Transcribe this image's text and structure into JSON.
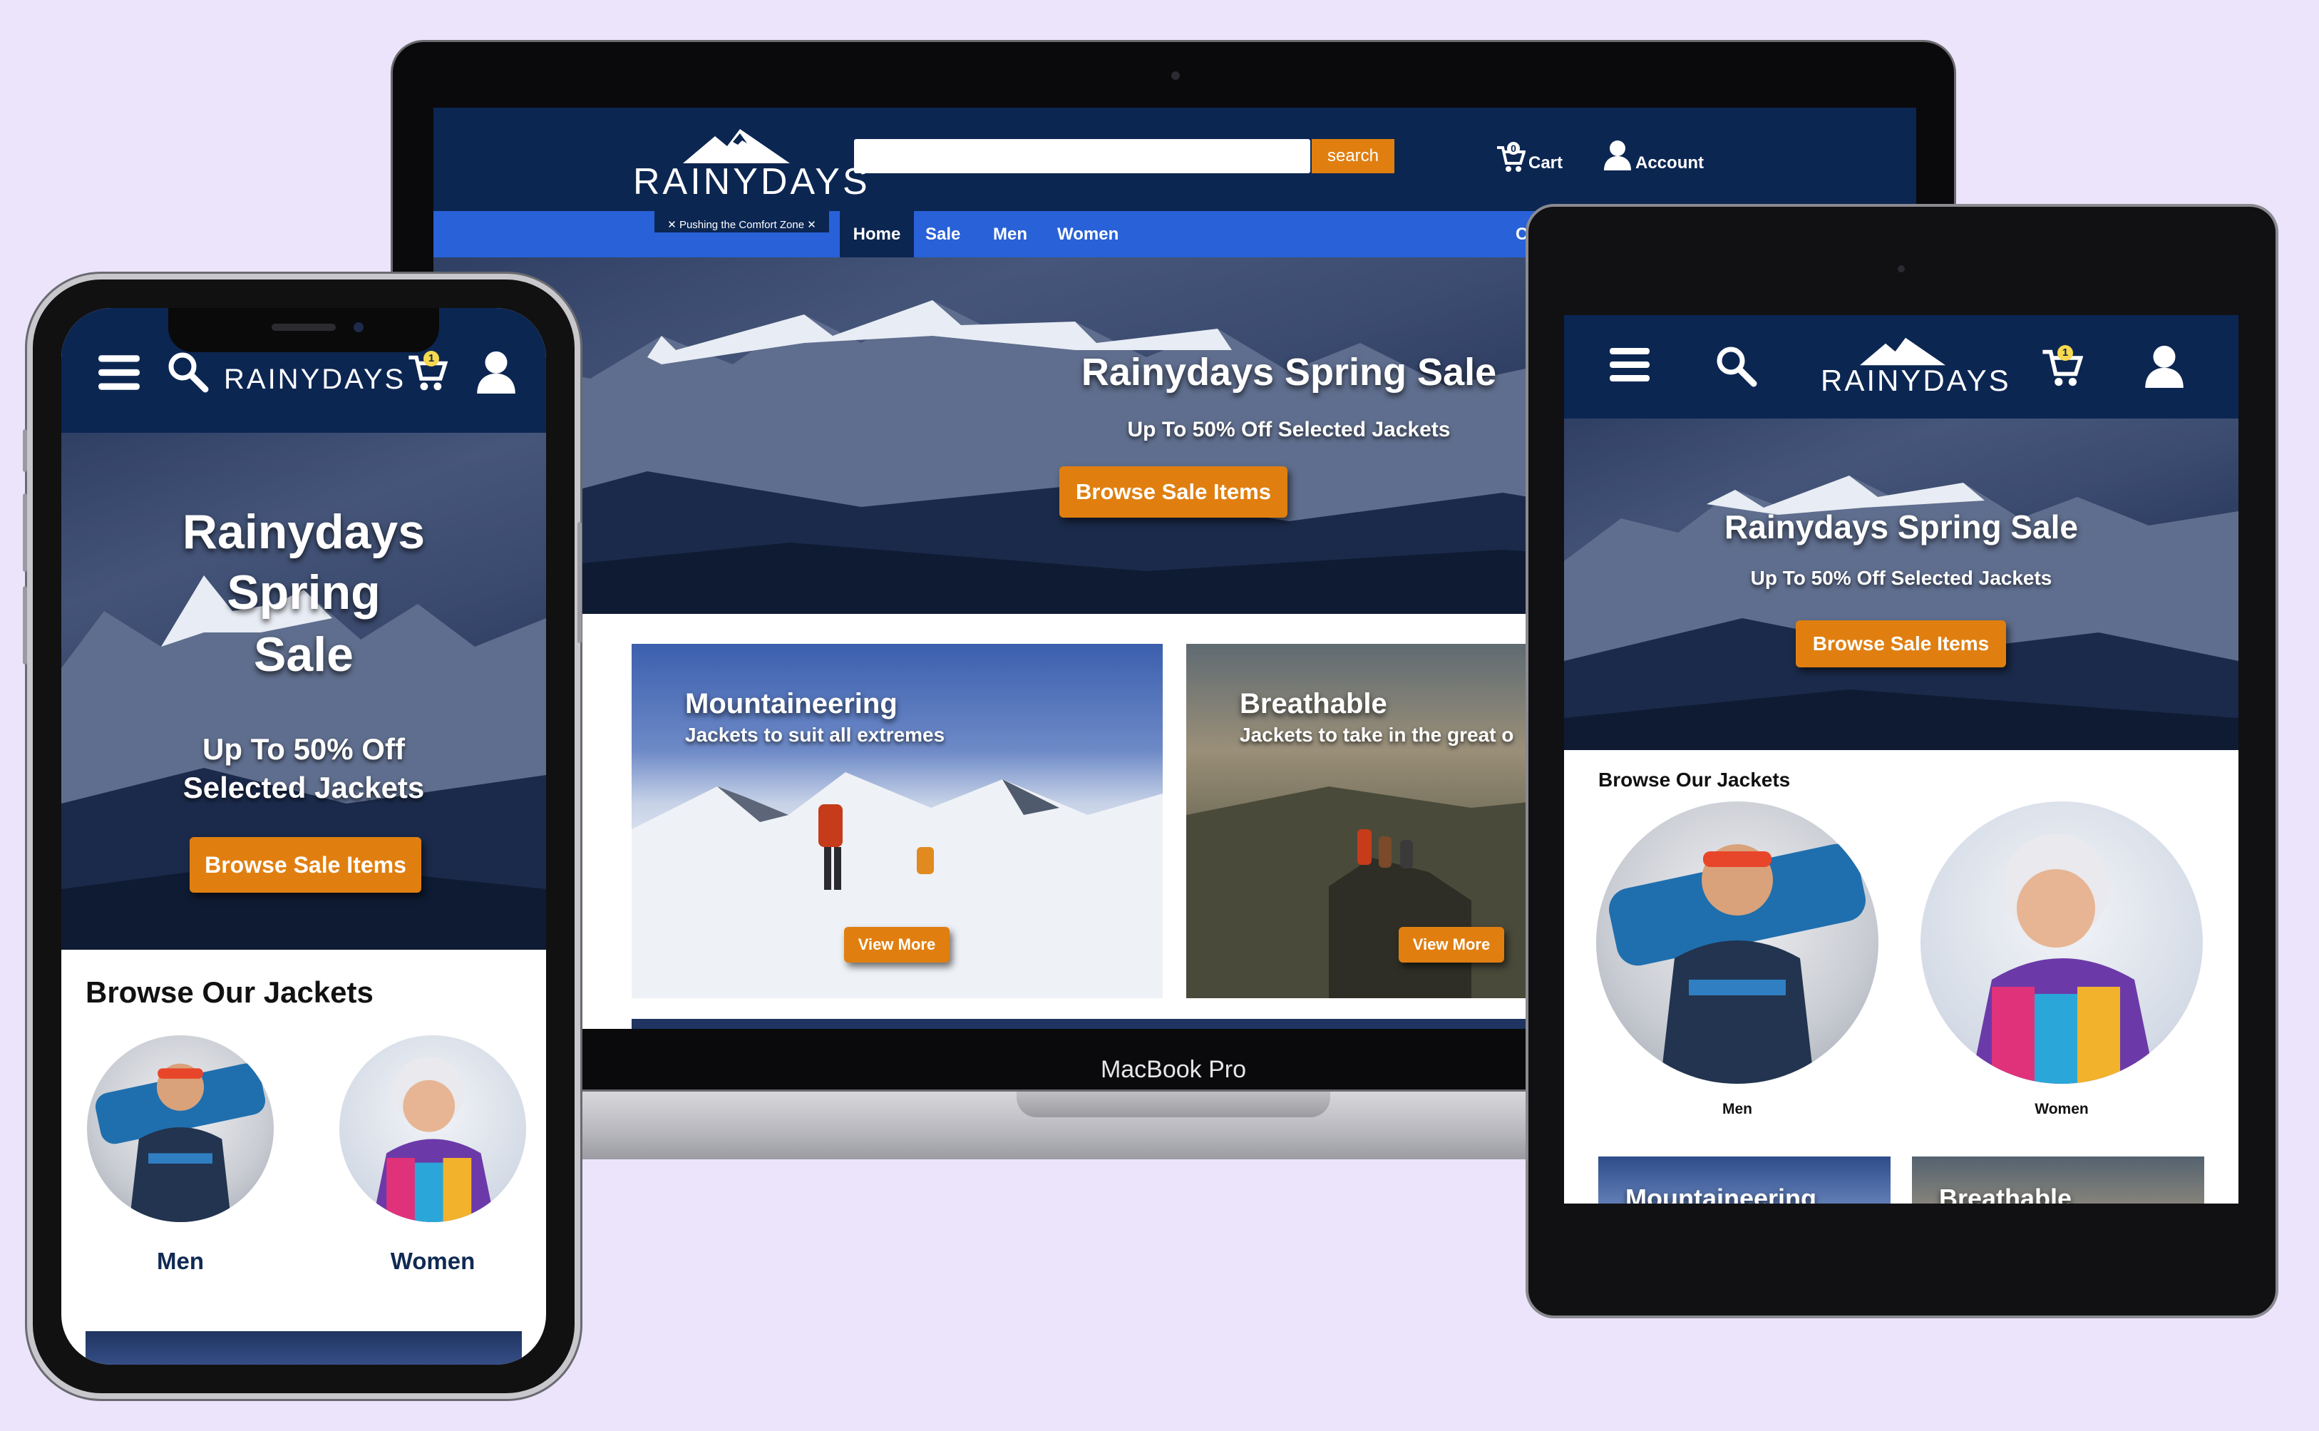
{
  "brand": {
    "name": "RAINYDAYS",
    "tagline": "✕ Pushing the Comfort Zone ✕"
  },
  "colors": {
    "navy": "#0c2652",
    "nav_blue": "#2861d8",
    "accent_orange": "#e07f10",
    "background": "#ece4fb"
  },
  "laptop": {
    "device_label": "MacBook Pro",
    "search_button": "search",
    "search_placeholder": "",
    "cart_label": "Cart",
    "cart_count": "0",
    "account_label": "Account",
    "nav": [
      "Home",
      "Sale",
      "Men",
      "Women"
    ],
    "nav_clipped": "C",
    "hero": {
      "title": "Rainydays Spring Sale",
      "subtitle": "Up To 50% Off Selected Jackets",
      "cta": "Browse Sale Items"
    },
    "cards": [
      {
        "title": "Mountaineering",
        "subtitle": "Jackets to suit all extremes",
        "cta": "View More"
      },
      {
        "title": "Breathable",
        "subtitle": "Jackets to take in the great o",
        "cta": "View More"
      }
    ]
  },
  "phone": {
    "cart_count": "1",
    "hero": {
      "title_lines": [
        "Rainydays",
        "Spring",
        "Sale"
      ],
      "subtitle_lines": [
        "Up To 50% Off",
        "Selected Jackets"
      ],
      "cta": "Browse Sale Items"
    },
    "browse_heading": "Browse Our Jackets",
    "categories": [
      "Men",
      "Women"
    ]
  },
  "tablet": {
    "cart_count": "1",
    "hero": {
      "title": "Rainydays Spring Sale",
      "subtitle": "Up To 50% Off Selected Jackets",
      "cta": "Browse Sale Items"
    },
    "browse_heading": "Browse Our Jackets",
    "categories": [
      "Men",
      "Women"
    ],
    "cards_partial": [
      "Mountaineering",
      "Breathable"
    ]
  }
}
